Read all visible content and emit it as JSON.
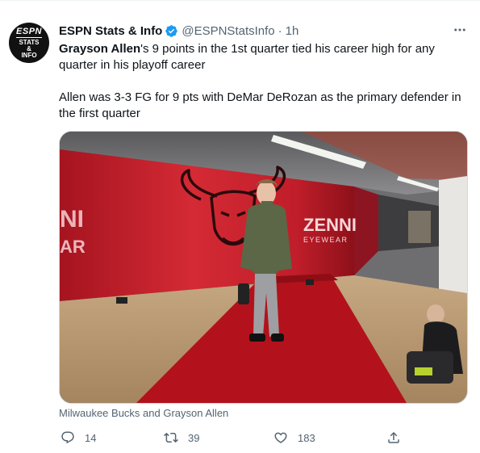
{
  "tweet": {
    "author_name": "ESPN Stats & Info",
    "handle": "@ESPNStatsInfo",
    "separator": "·",
    "time": "1h",
    "avatar_text": {
      "brand": "ESPN",
      "line1": "STATS",
      "line2": "&",
      "line3": "INFO"
    },
    "text": {
      "highlight": "Grayson Allen",
      "rest": "'s 9 points in the 1st quarter tied his career high for any quarter in his playoff career",
      "paragraph2": "Allen was 3-3 FG for 9 pts with DeMar DeRozan as the primary defender in the first quarter"
    },
    "media": {
      "wall_brand": "ZENNI",
      "wall_brand_sub": "EYEWEAR",
      "left_fragment_1": "NI",
      "left_fragment_2": "AR"
    },
    "caption": "Milwaukee Bucks and Grayson Allen",
    "actions": {
      "replies": "14",
      "retweets": "39",
      "likes": "183"
    },
    "colors": {
      "verified": "#1d9bf0",
      "text_muted": "#536471",
      "wall_red": "#c8202f",
      "carpet_red": "#b3121c"
    }
  }
}
